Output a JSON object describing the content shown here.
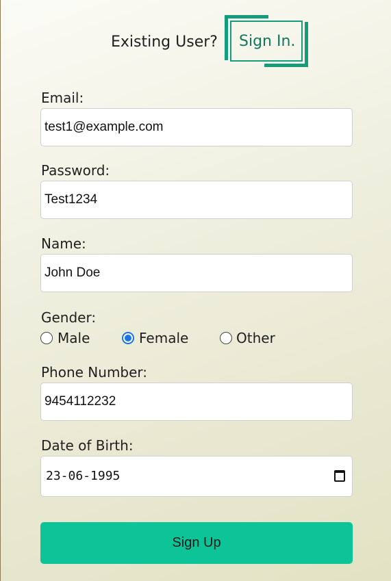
{
  "header": {
    "existing_user_text": "Existing User?",
    "signin_label": "Sign In."
  },
  "form": {
    "email": {
      "label": "Email:",
      "value": "test1@example.com"
    },
    "password": {
      "label": "Password:",
      "value": "Test1234"
    },
    "name": {
      "label": "Name:",
      "value": "John Doe"
    },
    "gender": {
      "label": "Gender:",
      "options": [
        "Male",
        "Female",
        "Other"
      ],
      "selected": "Female"
    },
    "phone": {
      "label": "Phone Number:",
      "value": "9454112232"
    },
    "dob": {
      "label": "Date of Birth:",
      "value": "23-06-1995"
    },
    "submit_label": "Sign Up"
  },
  "colors": {
    "accent": "#0cc497",
    "signin_frame": "#149c7c",
    "radio_checked": "#1a73e8"
  }
}
